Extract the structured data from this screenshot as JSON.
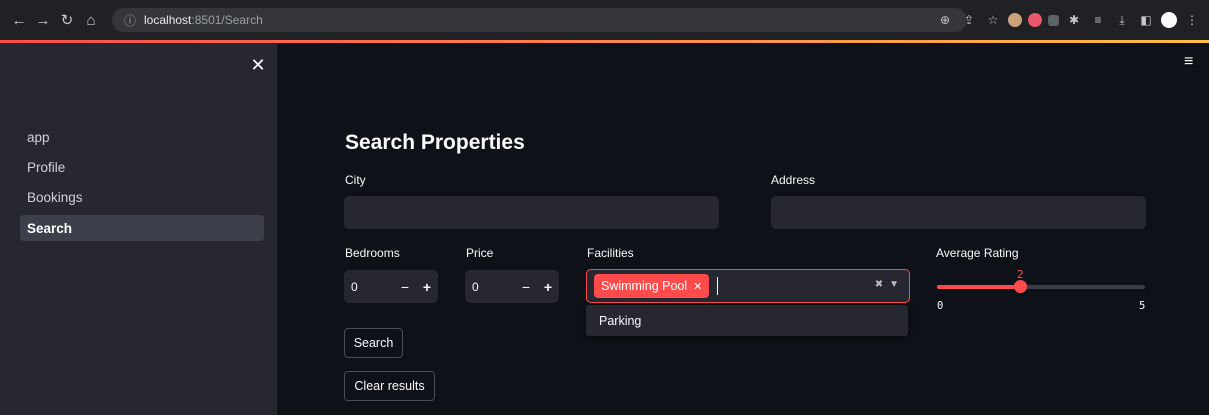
{
  "browser": {
    "url_host": "localhost",
    "url_path": ":8501/Search",
    "nav_icons": [
      "back-arrow-icon",
      "forward-arrow-icon",
      "reload-icon",
      "home-icon"
    ],
    "extension_icons": [
      "zoom-icon",
      "share-icon",
      "star-icon",
      "extension-icon",
      "shield-extension-icon",
      "extension-icon",
      "puzzle-icon",
      "reading-list-icon",
      "download-icon",
      "sidepanel-icon",
      "profile-icon",
      "kebab-menu-icon"
    ]
  },
  "sidebar": {
    "close_glyph": "✕",
    "items": [
      {
        "label": "app"
      },
      {
        "label": "Profile"
      },
      {
        "label": "Bookings"
      },
      {
        "label": "Search",
        "active": true
      }
    ]
  },
  "main": {
    "menu_glyph": "≡",
    "title": "Search Properties",
    "city_label": "City",
    "city_value": "",
    "address_label": "Address",
    "address_value": "",
    "bedrooms_label": "Bedrooms",
    "bedrooms_value": "0",
    "price_label": "Price",
    "price_value": "0",
    "stepper_minus": "−",
    "stepper_plus": "+",
    "facilities_label": "Facilities",
    "facilities_selected": "Swimming Pool",
    "tag_remove_glyph": "✕",
    "facilities_option": "Parking",
    "rating_label": "Average Rating",
    "rating_value": 2,
    "rating_value_text": "2",
    "rating_min": 0,
    "rating_max": 5,
    "rating_min_text": "0",
    "rating_max_text": "5",
    "search_button": "Search",
    "clear_button": "Clear results"
  },
  "colors": {
    "accent": "#ff4b4b",
    "background": "#0e1117",
    "sidebar": "#262730",
    "input": "#262730"
  }
}
